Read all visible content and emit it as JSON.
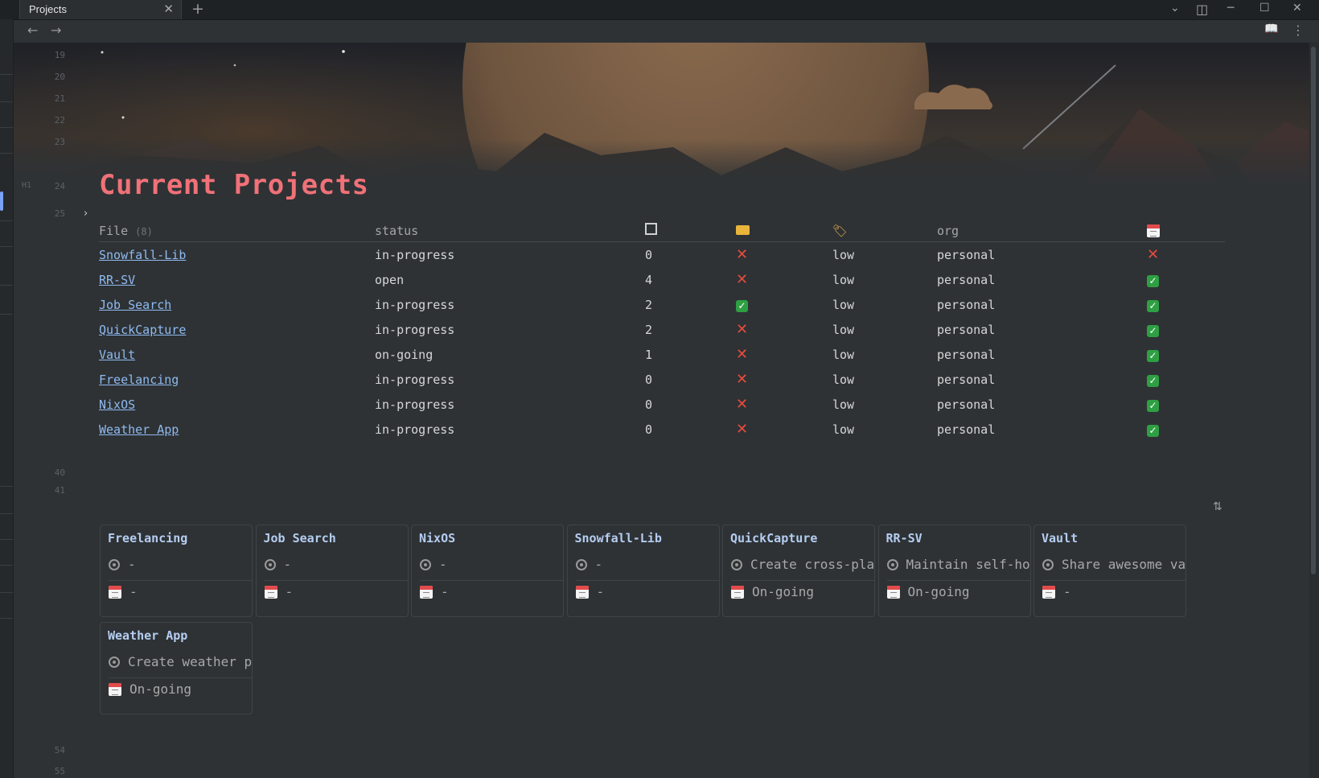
{
  "window": {
    "tab_title": "Projects",
    "tab_close": "✕",
    "new_tab": "+",
    "controls": {
      "dropdown": "⌄",
      "layout": "◫",
      "minimize": "─",
      "maximize": "☐",
      "close": "✕"
    }
  },
  "navbar": {
    "back": "←",
    "forward": "→",
    "reading_mode": "📖",
    "more": "⋮"
  },
  "editor": {
    "line_numbers_top": [
      "19",
      "20",
      "21",
      "22",
      "23",
      "24",
      "25"
    ],
    "heading_marker": "H1",
    "line_numbers_bottom": [
      "40",
      "41",
      "54",
      "55"
    ],
    "fold_toggle": "›",
    "title": "Current Projects"
  },
  "table": {
    "headers": {
      "file": "File",
      "file_count": "(8)",
      "status": "status",
      "tasks_icon": "checkbox-icon",
      "ticket_icon": "ticket-icon",
      "tag_icon": "tag-icon",
      "org": "org",
      "calendar_icon": "calendar-icon"
    },
    "rows": [
      {
        "file": "Snowfall-Lib",
        "status": "in-progress",
        "tasks": "0",
        "ticket": false,
        "priority": "low",
        "org": "personal",
        "date": false
      },
      {
        "file": "RR-SV",
        "status": "open",
        "tasks": "4",
        "ticket": false,
        "priority": "low",
        "org": "personal",
        "date": true
      },
      {
        "file": "Job Search",
        "status": "in-progress",
        "tasks": "2",
        "ticket": true,
        "priority": "low",
        "org": "personal",
        "date": true
      },
      {
        "file": "QuickCapture",
        "status": "in-progress",
        "tasks": "2",
        "ticket": false,
        "priority": "low",
        "org": "personal",
        "date": true
      },
      {
        "file": "Vault",
        "status": "on-going",
        "tasks": "1",
        "ticket": false,
        "priority": "low",
        "org": "personal",
        "date": true
      },
      {
        "file": "Freelancing",
        "status": "in-progress",
        "tasks": "0",
        "ticket": false,
        "priority": "low",
        "org": "personal",
        "date": true
      },
      {
        "file": "NixOS",
        "status": "in-progress",
        "tasks": "0",
        "ticket": false,
        "priority": "low",
        "org": "personal",
        "date": true
      },
      {
        "file": "Weather App",
        "status": "in-progress",
        "tasks": "0",
        "ticket": false,
        "priority": "low",
        "org": "personal",
        "date": true
      }
    ]
  },
  "cards": {
    "sort_icon": "⇅",
    "items": [
      {
        "title": "Freelancing",
        "goal": "-",
        "date": "-"
      },
      {
        "title": "Job Search",
        "goal": "-",
        "date": "-"
      },
      {
        "title": "NixOS",
        "goal": "-",
        "date": "-"
      },
      {
        "title": "Snowfall-Lib",
        "goal": "-",
        "date": "-"
      },
      {
        "title": "QuickCapture",
        "goal": "Create cross-pla",
        "date": "On-going"
      },
      {
        "title": "RR-SV",
        "goal": "Maintain self-ho",
        "date": "On-going"
      },
      {
        "title": "Vault",
        "goal": "Share awesome va",
        "date": "-"
      },
      {
        "title": "Weather App",
        "goal": "Create weather p",
        "date": "On-going"
      }
    ]
  },
  "colors": {
    "background": "#2e3235",
    "title": "#f07178",
    "link": "#8fbaf0",
    "card_title": "#b5cdf0",
    "no_mark": "#e74c3c",
    "yes_mark": "#2ea043"
  }
}
